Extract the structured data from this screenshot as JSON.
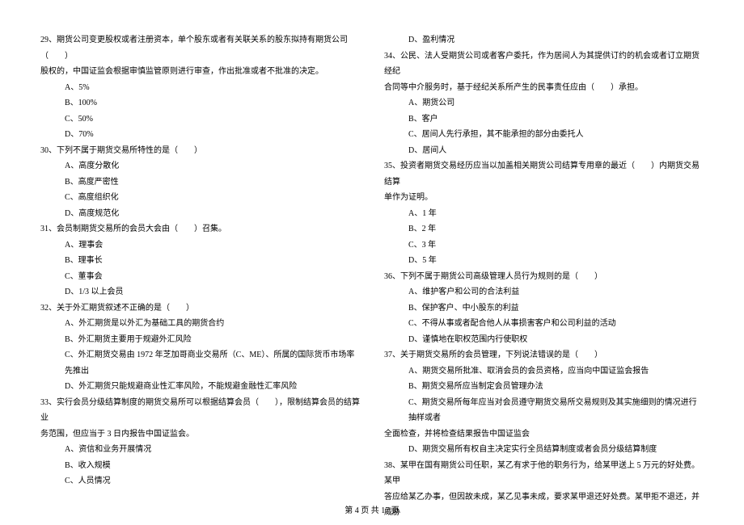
{
  "left": {
    "q29": {
      "line1": "29、期货公司变更股权或者注册资本，单个股东或者有关联关系的股东拟持有期货公司（　　）",
      "line2": "股权的，中国证监会根据审慎监管原则进行审查，作出批准或者不批准的决定。",
      "a": "A、5%",
      "b": "B、100%",
      "c": "C、50%",
      "d": "D、70%"
    },
    "q30": {
      "line1": "30、下列不属于期货交易所特性的是（　　）",
      "a": "A、高度分散化",
      "b": "B、高度严密性",
      "c": "C、高度组织化",
      "d": "D、高度规范化"
    },
    "q31": {
      "line1": "31、会员制期货交易所的会员大会由（　　）召集。",
      "a": "A、理事会",
      "b": "B、理事长",
      "c": "C、董事会",
      "d": "D、1/3 以上会员"
    },
    "q32": {
      "line1": "32、关于外汇期货叙述不正确的是（　　）",
      "a": "A、外汇期货是以外汇为基础工具的期货合约",
      "b": "B、外汇期货主要用于规避外汇风险",
      "c": "C、外汇期货交易由 1972 年芝加哥商业交易所（C、ME）、所属的国际货币市场率先推出",
      "d": "D、外汇期货只能规避商业性汇率风险，不能规避金融性汇率风险"
    },
    "q33": {
      "line1": "33、实行会员分级结算制度的期货交易所可以根据结算会员（　　），限制结算会员的结算业",
      "line2": "务范围，但应当于 3 日内报告中国证监会。",
      "a": "A、资信和业务开展情况",
      "b": "B、收入规模",
      "c": "C、人员情况"
    }
  },
  "right": {
    "q33d": "D、盈利情况",
    "q34": {
      "line1": "34、公民、法人受期货公司或者客户委托，作为居间人为其提供订约的机会或者订立期货经纪",
      "line2": "合同等中介服务时，基于经纪关系所产生的民事责任应由（　　）承担。",
      "a": "A、期货公司",
      "b": "B、客户",
      "c": "C、居间人先行承担，其不能承担的部分由委托人",
      "d": "D、居间人"
    },
    "q35": {
      "line1": "35、投资者期货交易经历应当以加盖相关期货公司结算专用章的最近（　　）内期货交易结算",
      "line2": "单作为证明。",
      "a": "A、1 年",
      "b": "B、2 年",
      "c": "C、3 年",
      "d": "D、5 年"
    },
    "q36": {
      "line1": "36、下列不属于期货公司高级管理人员行为规则的是（　　）",
      "a": "A、维护客户和公司的合法利益",
      "b": "B、保护客户、中小股东的利益",
      "c": "C、不得从事或者配合他人从事损害客户和公司利益的活动",
      "d": "D、谨慎地在职权范围内行使职权"
    },
    "q37": {
      "line1": "37、关于期货交易所的会员管理，下列说法错误的是（　　）",
      "a": "A、期货交易所批准、取消会员的会员资格，应当向中国证监会报告",
      "b": "B、期货交易所应当制定会员管理办法",
      "c": "C、期货交易所每年应当对会员遵守期货交易所交易规则及其实施细则的情况进行抽样或者",
      "c2": "全面检查，并将检查结果报告中国证监会",
      "d": "D、期货交易所有权自主决定实行全员结算制度或者会员分级结算制度"
    },
    "q38": {
      "line1": "38、某甲在国有期货公司任职，某乙有求于他的职务行为，给某甲送上 5 万元的好处费。某甲",
      "line2": "答应给某乙办事，但因故未成，某乙见事未成，要求某甲退还好处费。某甲拒不退还，并威胁"
    }
  },
  "footer": "第 4 页 共 17 页"
}
